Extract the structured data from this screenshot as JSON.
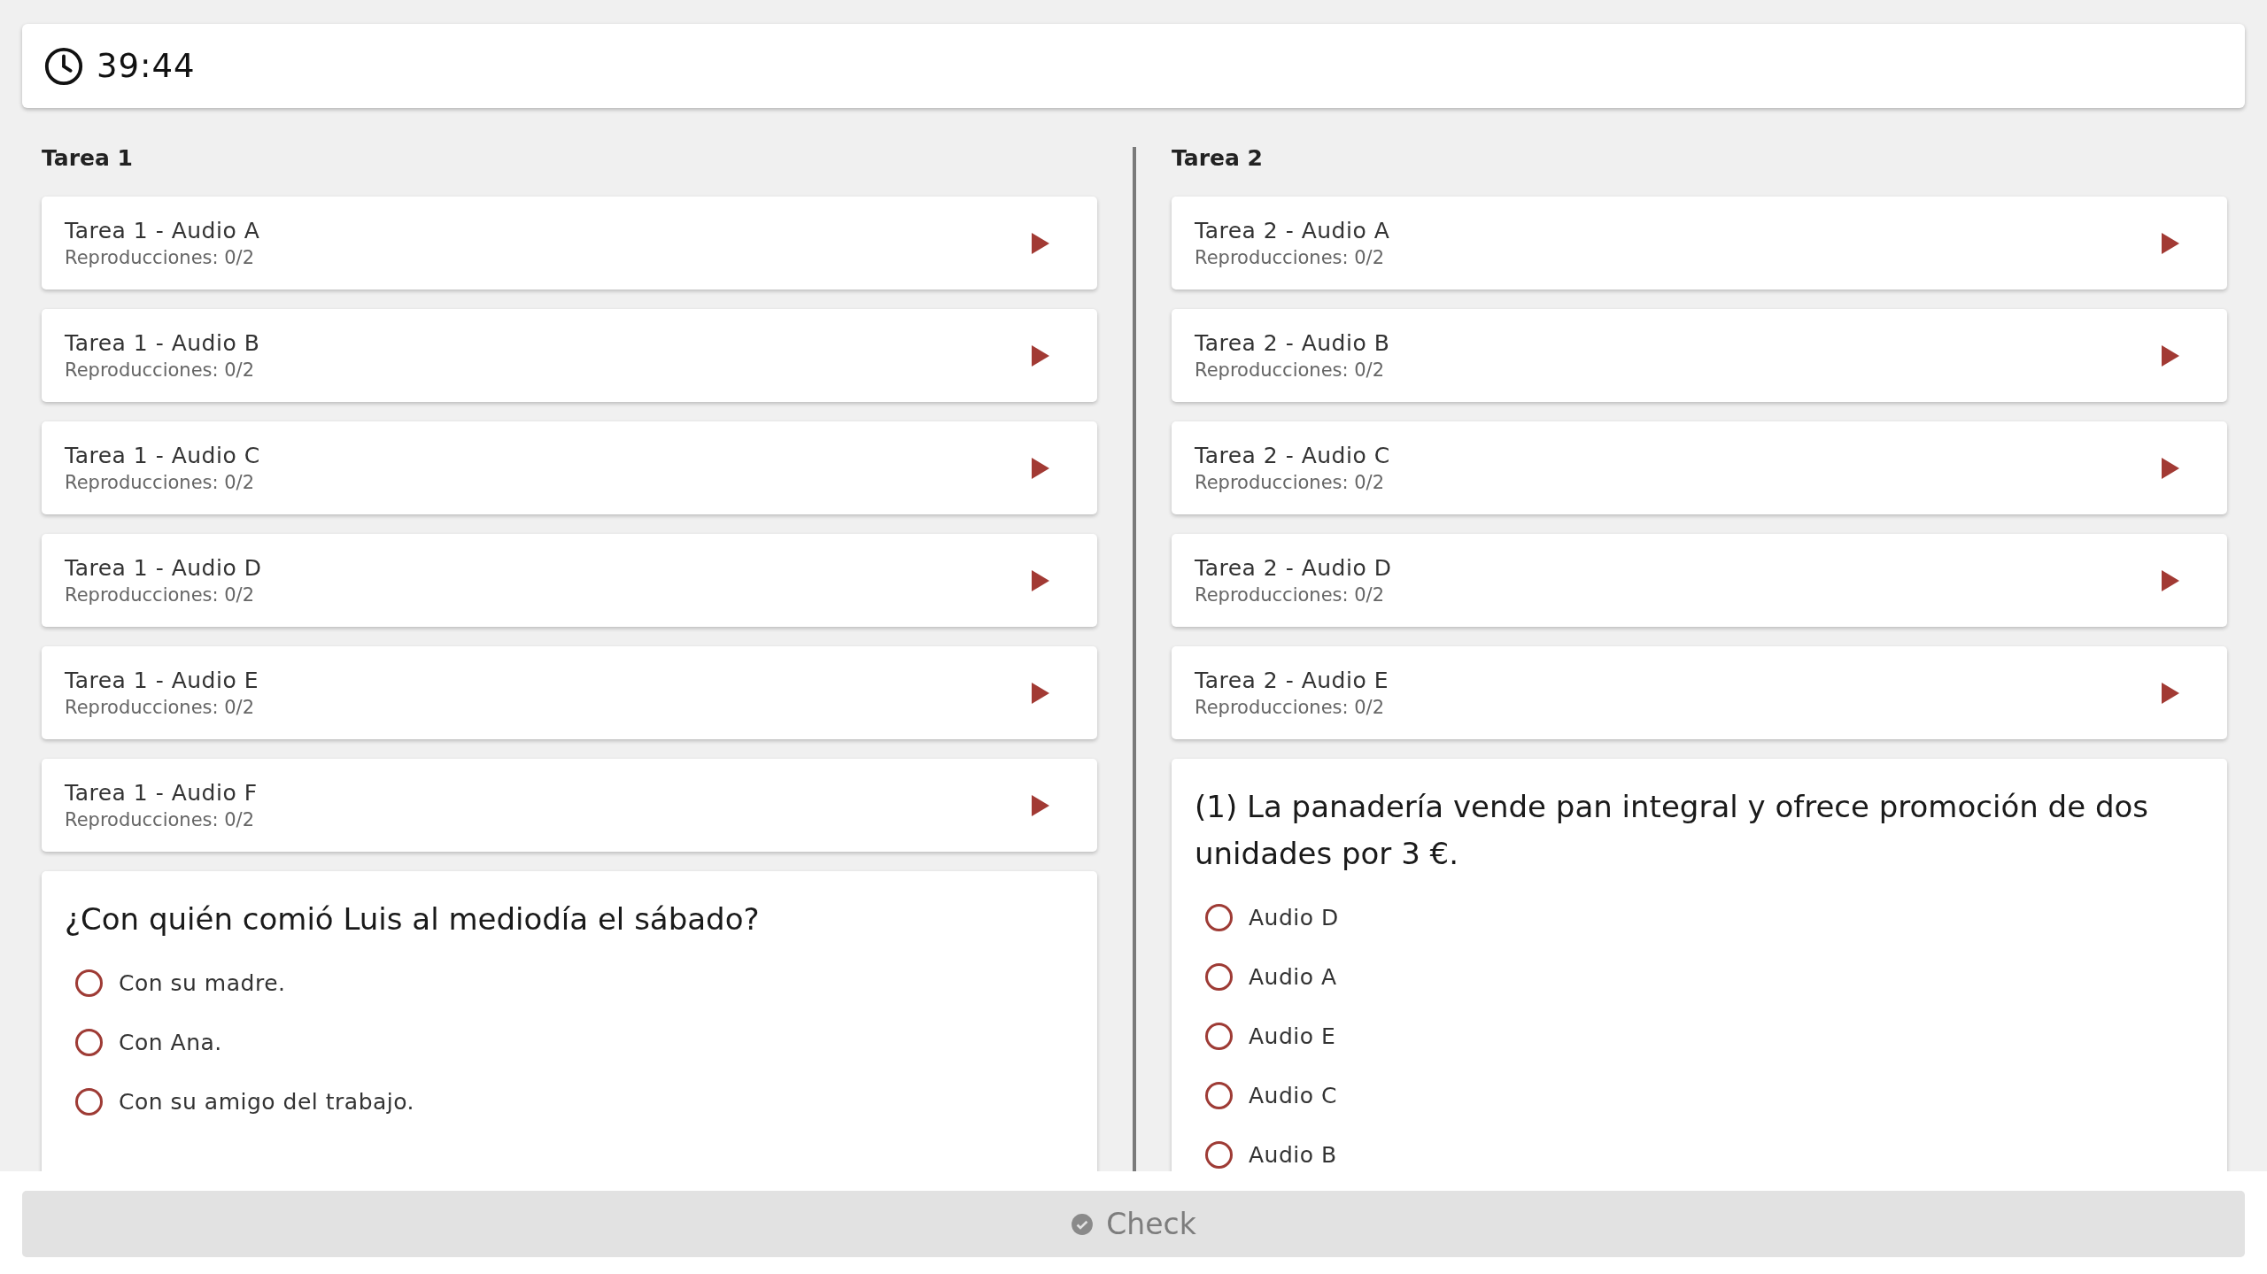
{
  "timer": {
    "time": "39:44"
  },
  "columns": [
    {
      "title": "Tarea 1",
      "audios": [
        {
          "title": "Tarea 1 - Audio A",
          "plays": "Reproducciones: 0/2"
        },
        {
          "title": "Tarea 1 - Audio B",
          "plays": "Reproducciones: 0/2"
        },
        {
          "title": "Tarea 1 - Audio C",
          "plays": "Reproducciones: 0/2"
        },
        {
          "title": "Tarea 1 - Audio D",
          "plays": "Reproducciones: 0/2"
        },
        {
          "title": "Tarea 1 - Audio E",
          "plays": "Reproducciones: 0/2"
        },
        {
          "title": "Tarea 1 - Audio F",
          "plays": "Reproducciones: 0/2"
        }
      ],
      "questions": [
        {
          "prompt": "¿Con quién comió Luis al mediodía el sábado?",
          "options": [
            {
              "label": "Con su madre.",
              "selected": false
            },
            {
              "label": "Con Ana.",
              "selected": false
            },
            {
              "label": "Con su amigo del trabajo.",
              "selected": false
            }
          ]
        }
      ]
    },
    {
      "title": "Tarea 2",
      "audios": [
        {
          "title": "Tarea 2 - Audio A",
          "plays": "Reproducciones: 0/2"
        },
        {
          "title": "Tarea 2 - Audio B",
          "plays": "Reproducciones: 0/2"
        },
        {
          "title": "Tarea 2 - Audio C",
          "plays": "Reproducciones: 0/2"
        },
        {
          "title": "Tarea 2 - Audio D",
          "plays": "Reproducciones: 0/2"
        },
        {
          "title": "Tarea 2 - Audio E",
          "plays": "Reproducciones: 0/2"
        }
      ],
      "questions": [
        {
          "prompt": "(1) La panadería vende pan integral y ofrece promoción de dos unidades por 3 €.",
          "options": [
            {
              "label": "Audio D",
              "selected": false
            },
            {
              "label": "Audio A",
              "selected": false
            },
            {
              "label": "Audio E",
              "selected": false
            },
            {
              "label": "Audio C",
              "selected": false
            },
            {
              "label": "Audio B",
              "selected": false
            }
          ]
        }
      ]
    }
  ],
  "check_button": {
    "label": "Check",
    "disabled": true
  }
}
